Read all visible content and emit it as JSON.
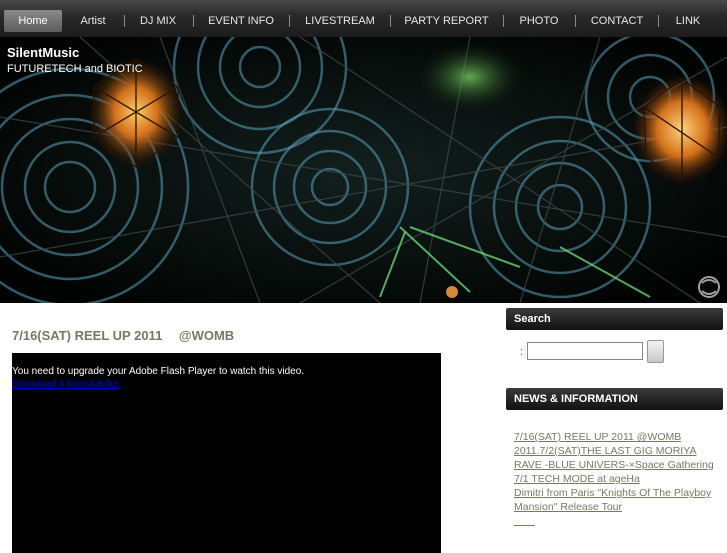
{
  "nav": {
    "items": [
      {
        "label": "Home",
        "active": true
      },
      {
        "label": "Artist"
      },
      {
        "label": "DJ MIX"
      },
      {
        "label": "EVENT INFO"
      },
      {
        "label": "LIVESTREAM"
      },
      {
        "label": "PARTY REPORT"
      },
      {
        "label": "PHOTO"
      },
      {
        "label": "CONTACT"
      },
      {
        "label": "LINK"
      }
    ]
  },
  "header": {
    "site_title": "SilentMusic",
    "subtitle": "FUTURETECH and BIOTIC"
  },
  "post": {
    "title": "7/16(SAT) REEL UP 2011 　@WOMB",
    "flash_message": "You need to upgrade your Adobe Flash Player to watch this video.",
    "flash_link": "Download it from Adobe."
  },
  "sidebar": {
    "search_title": "Search",
    "search_colon": ":",
    "search_value": "",
    "news_title": "NEWS & INFORMATION",
    "news_items": [
      "7/16(SAT) REEL UP 2011 @WOMB",
      "2011.7/2(SAT)THE LAST GIG MORIYA RAVE -BLUE UNIVERS-×Space Gathering",
      "7/1 TECH MODE at ageHa",
      "Dimitri from Paris \"Knights Of The Playboy Mansion\" Release Tour",
      "　　"
    ]
  }
}
